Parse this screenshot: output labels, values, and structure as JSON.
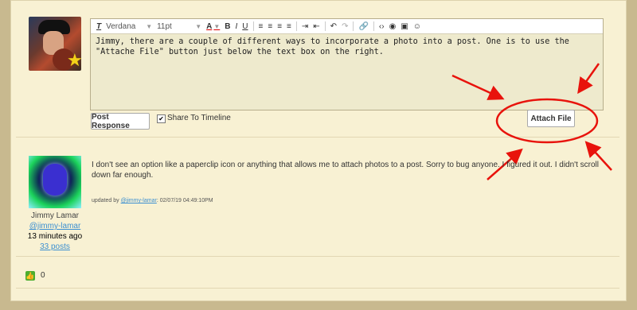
{
  "composer": {
    "toolbar": {
      "font": "Verdana",
      "size": "11pt",
      "icons": [
        "clear-format-icon",
        "font-color-icon",
        "bold-icon",
        "italic-icon",
        "underline-icon",
        "align-left-icon",
        "align-center-icon",
        "align-right-icon",
        "justify-icon",
        "indent-icon",
        "outdent-icon",
        "undo-icon",
        "redo-icon",
        "link-icon",
        "code-icon",
        "preview-icon",
        "media-icon",
        "emoji-icon"
      ]
    },
    "text": "Jimmy, there are a couple of different ways to incorporate a photo into a post.  One is to use the \"Attache File\" button just below the text box on the right.",
    "post_button": "Post Response",
    "share_label": "Share To Timeline",
    "share_checked": true,
    "attach_button": "Attach File"
  },
  "reply": {
    "text": "I don't see an option like a paperclip icon or anything that allows me to attach photos to a post. Sorry to bug anyone. I figured it out. I didn't scroll down far enough.",
    "updated_prefix": "updated by ",
    "updated_user": "@jimmy-lamar",
    "updated_suffix": ": 02/07/19 04:49:10PM",
    "author_name": "Jimmy Lamar",
    "author_handle": "@jimmy-lamar",
    "time_ago": "13 minutes ago",
    "posts": "33 posts"
  },
  "likes": {
    "count": "0"
  },
  "colors": {
    "annotation": "#e8130c",
    "link": "#3b8fd1",
    "like": "#4cae2e"
  }
}
